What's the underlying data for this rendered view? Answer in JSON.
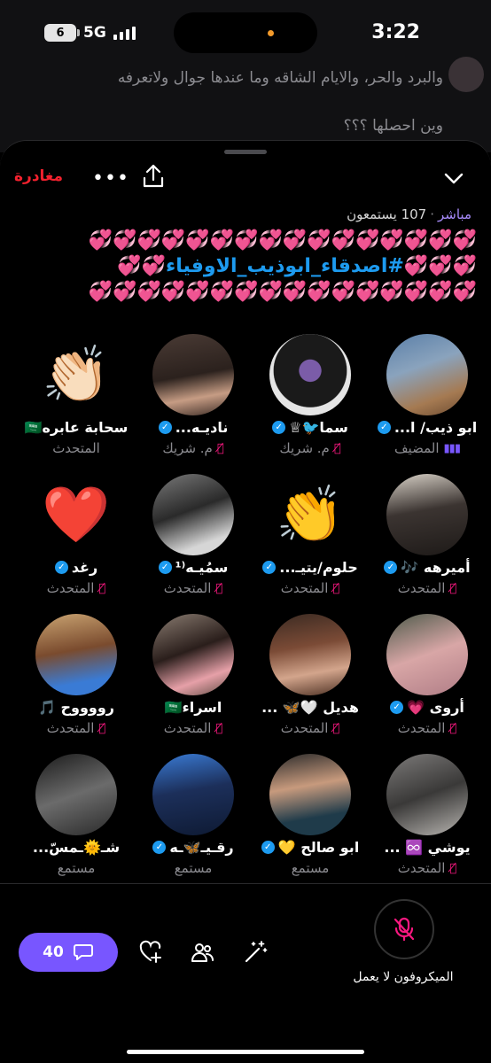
{
  "status_bar": {
    "time": "3:22",
    "battery": "6",
    "network": "5G"
  },
  "background_tweet": {
    "line1": "والبرد والحر، والايام الشاقه وما عندها جوال ولاتعرفه",
    "line2": "وين احصلها ؟؟؟"
  },
  "header": {
    "leave_label": "مغادرة",
    "more_label": "•••"
  },
  "space": {
    "live_label": "مباشر",
    "listeners_label": "107 يستمعون",
    "title_line1": "💞💞💞💞💞💞💞💞💞💞💞💞💞💞💞💞",
    "title_line2_prefix": "💞💞💞",
    "title_tag": "#اصدقاء_ابوذيب_الاوفياء",
    "title_line2_suffix": "💞💞",
    "title_line3": "💞💞💞💞💞💞💞💞💞💞💞💞💞💞💞💞",
    "title_color": "#ff4fb4",
    "tag_color": "#1d9bf0"
  },
  "participants": [
    {
      "name": "ابو ذيب/ ا...",
      "role": "المضيف",
      "verified": true,
      "icon": "host-speaking-icon",
      "avatar": "horse-rider-photo"
    },
    {
      "name": "سما🐦♕",
      "role": "م. شريك",
      "verified": true,
      "icon": "mic-off-icon",
      "avatar": "heart-mask-photo"
    },
    {
      "name": "ناديـه...",
      "role": "م. شريك",
      "verified": true,
      "icon": "mic-off-icon",
      "avatar": "woman-portrait-photo"
    },
    {
      "name": "سحابة عابره🇸🇦",
      "role": "المتحدث",
      "verified": false,
      "icon": "",
      "avatar": "👏🏻"
    },
    {
      "name": "أميرهه 🎶",
      "role": "المتحدث",
      "verified": true,
      "icon": "mic-off-icon",
      "avatar": "woman-hijab-photo"
    },
    {
      "name": "حلوم/يتيـ...",
      "role": "المتحدث",
      "verified": true,
      "icon": "mic-off-icon",
      "avatar": "👏"
    },
    {
      "name": "سمُيـه⁽¹",
      "role": "المتحدث",
      "verified": true,
      "icon": "mic-off-icon",
      "avatar": "bw-woman-photo"
    },
    {
      "name": "رغد",
      "role": "المتحدث",
      "verified": true,
      "icon": "mic-off-icon",
      "avatar": "❤️"
    },
    {
      "name": "أروى 💗",
      "role": "المتحدث",
      "verified": true,
      "icon": "mic-off-icon",
      "avatar": "pink-hijab-photo"
    },
    {
      "name": "هديل 🤍🦋 ...",
      "role": "المتحدث",
      "verified": false,
      "icon": "mic-off-icon",
      "avatar": "long-hair-photo"
    },
    {
      "name": "اسراء🇸🇦",
      "role": "المتحدث",
      "verified": false,
      "icon": "mic-off-icon",
      "avatar": "rose-woman-photo"
    },
    {
      "name": "رووووح 🎵",
      "role": "المتحدث",
      "verified": false,
      "icon": "mic-off-icon",
      "avatar": "sunglasses-photo"
    },
    {
      "name": "يوشي ♾️ ...",
      "role": "المتحدث",
      "verified": false,
      "icon": "mic-off-icon",
      "avatar": "car-window-photo"
    },
    {
      "name": "ابو صالح 💛",
      "role": "مستمع",
      "verified": true,
      "icon": "",
      "avatar": "footballer-photo"
    },
    {
      "name": "رقـيـ🦋ـه",
      "role": "مستمع",
      "verified": true,
      "icon": "",
      "avatar": "butterfly-photo"
    },
    {
      "name": "شـ🌞ـمسّ...",
      "role": "مستمع",
      "verified": false,
      "icon": "",
      "avatar": "bw-portrait-photo"
    }
  ],
  "bottom_bar": {
    "reply_count": "40",
    "mic_label": "الميكروفون لا يعمل"
  },
  "colors": {
    "accent": "#7856ff",
    "danger": "#f4212e",
    "verified": "#1d9bf0",
    "muted": "#8b8b90"
  }
}
